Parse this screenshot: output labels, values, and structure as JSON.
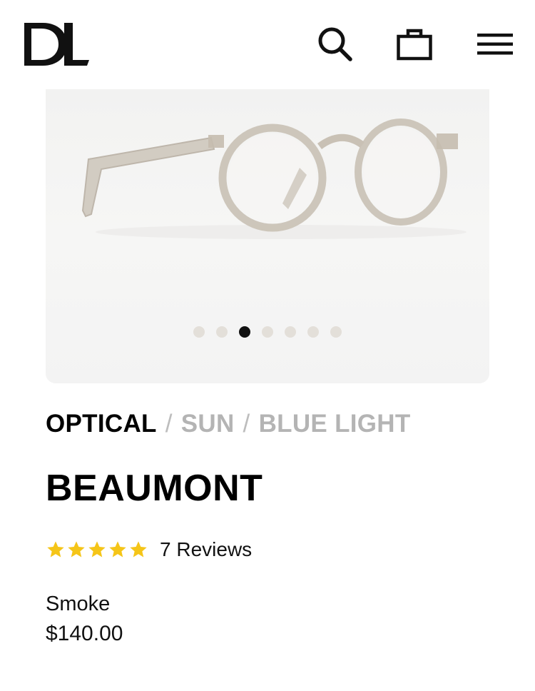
{
  "header": {
    "logo_text": "DL",
    "icons": [
      "search-icon",
      "bag-icon",
      "menu-icon"
    ]
  },
  "gallery": {
    "image_alt": "BEAUMONT frame in Smoke",
    "slide_count": 7,
    "active_slide": 3
  },
  "categories": [
    {
      "label": "OPTICAL",
      "active": true
    },
    {
      "label": "SUN",
      "active": false
    },
    {
      "label": "BLUE LIGHT",
      "active": false
    }
  ],
  "category_separator": "/",
  "product": {
    "name": "BEAUMONT",
    "rating": 5,
    "reviews_label": "7 Reviews",
    "color": "Smoke",
    "price": "$140.00"
  },
  "colors": {
    "star": "#f5c518",
    "active_dot": "#111111",
    "inactive_dot": "#e3dfd9",
    "inactive_category": "#b4b4b4"
  }
}
